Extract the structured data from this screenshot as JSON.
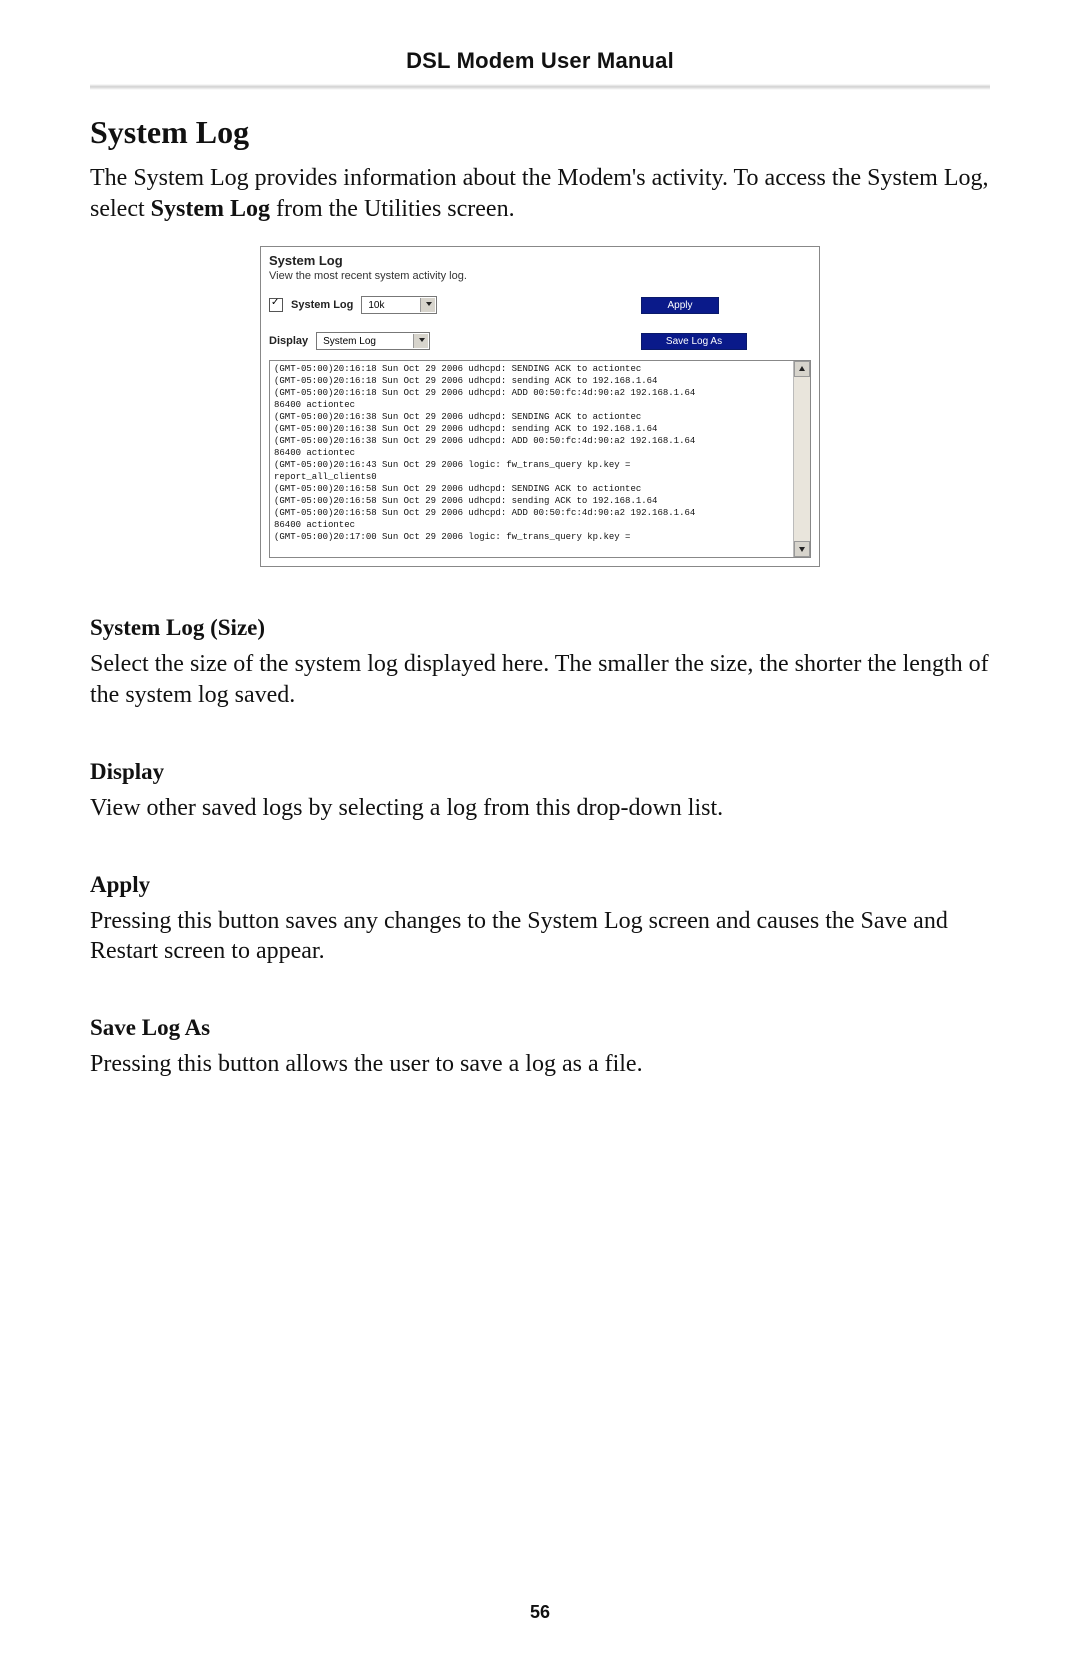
{
  "header": {
    "title": "DSL Modem User Manual"
  },
  "page_number": "56",
  "main": {
    "heading": "System Log",
    "intro_pre": "The System Log provides information about the Modem's activity. To access the System Log, select ",
    "intro_bold": "System Log",
    "intro_post": " from the Utilities screen."
  },
  "screenshot": {
    "panel_title": "System Log",
    "panel_subtitle": "View the most recent system activity log.",
    "checkbox_checked": true,
    "row1_label": "System Log",
    "size_select": "10k",
    "apply_btn": "Apply",
    "display_label": "Display",
    "display_select": "System Log",
    "save_btn": "Save Log As",
    "log_text": "(GMT-05:00)20:16:18 Sun Oct 29 2006 udhcpd: SENDING ACK to actiontec\n(GMT-05:00)20:16:18 Sun Oct 29 2006 udhcpd: sending ACK to 192.168.1.64\n(GMT-05:00)20:16:18 Sun Oct 29 2006 udhcpd: ADD 00:50:fc:4d:90:a2 192.168.1.64\n86400 actiontec\n(GMT-05:00)20:16:38 Sun Oct 29 2006 udhcpd: SENDING ACK to actiontec\n(GMT-05:00)20:16:38 Sun Oct 29 2006 udhcpd: sending ACK to 192.168.1.64\n(GMT-05:00)20:16:38 Sun Oct 29 2006 udhcpd: ADD 00:50:fc:4d:90:a2 192.168.1.64\n86400 actiontec\n(GMT-05:00)20:16:43 Sun Oct 29 2006 logic: fw_trans_query kp.key =\nreport_all_clients0\n(GMT-05:00)20:16:58 Sun Oct 29 2006 udhcpd: SENDING ACK to actiontec\n(GMT-05:00)20:16:58 Sun Oct 29 2006 udhcpd: sending ACK to 192.168.1.64\n(GMT-05:00)20:16:58 Sun Oct 29 2006 udhcpd: ADD 00:50:fc:4d:90:a2 192.168.1.64\n86400 actiontec\n(GMT-05:00)20:17:00 Sun Oct 29 2006 logic: fw_trans_query kp.key ="
  },
  "sections": {
    "size": {
      "heading": "System Log (Size)",
      "body": "Select the size of the system log displayed here. The smaller the size, the shorter the length of the system log saved."
    },
    "display": {
      "heading": "Display",
      "body": "View other saved logs by selecting a log from this drop-down list."
    },
    "apply": {
      "heading": "Apply",
      "body": "Pressing this button saves any changes to the System Log screen and causes the Save and Restart screen to appear."
    },
    "save": {
      "heading": "Save Log As",
      "body": "Pressing this button allows the user to save a log as a file."
    }
  }
}
